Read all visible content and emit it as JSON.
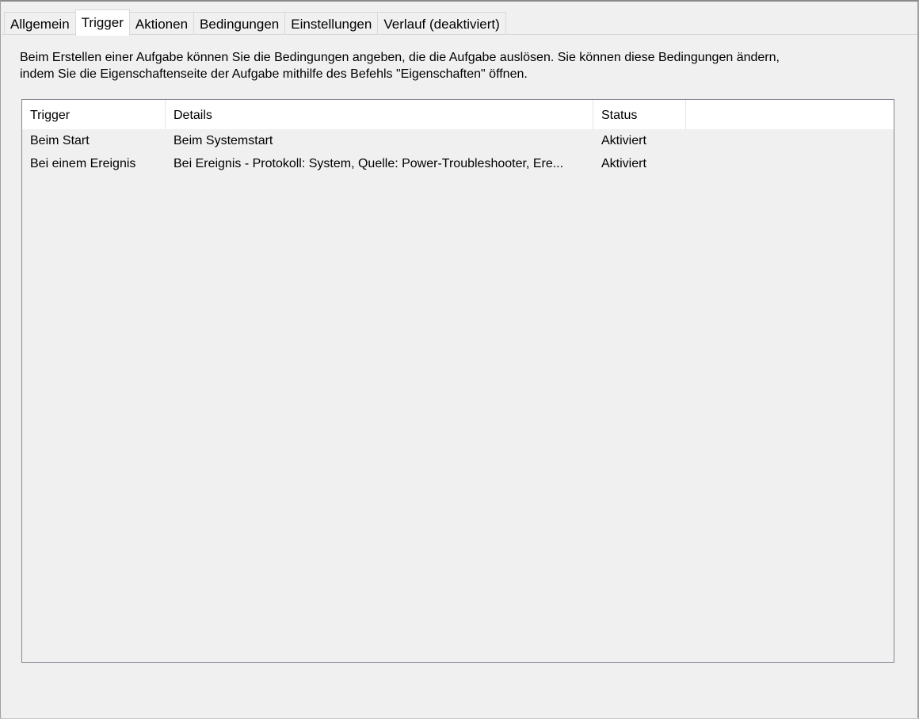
{
  "tabs": [
    {
      "label": "Allgemein",
      "active": false
    },
    {
      "label": "Trigger",
      "active": true
    },
    {
      "label": "Aktionen",
      "active": false
    },
    {
      "label": "Bedingungen",
      "active": false
    },
    {
      "label": "Einstellungen",
      "active": false
    },
    {
      "label": "Verlauf (deaktiviert)",
      "active": false
    }
  ],
  "description": "Beim Erstellen einer Aufgabe können Sie die Bedingungen angeben, die die Aufgabe auslösen. Sie können diese Bedingungen ändern,\nindem Sie die Eigenschaftenseite der Aufgabe mithilfe des Befehls \"Eigenschaften\" öffnen.",
  "table": {
    "columns": [
      "Trigger",
      "Details",
      "Status"
    ],
    "rows": [
      [
        "Beim Start",
        "Beim Systemstart",
        "Aktiviert"
      ],
      [
        "Bei einem Ereignis",
        "Bei Ereignis - Protokoll: System, Quelle: Power-Troubleshooter, Ere...",
        "Aktiviert"
      ]
    ]
  }
}
